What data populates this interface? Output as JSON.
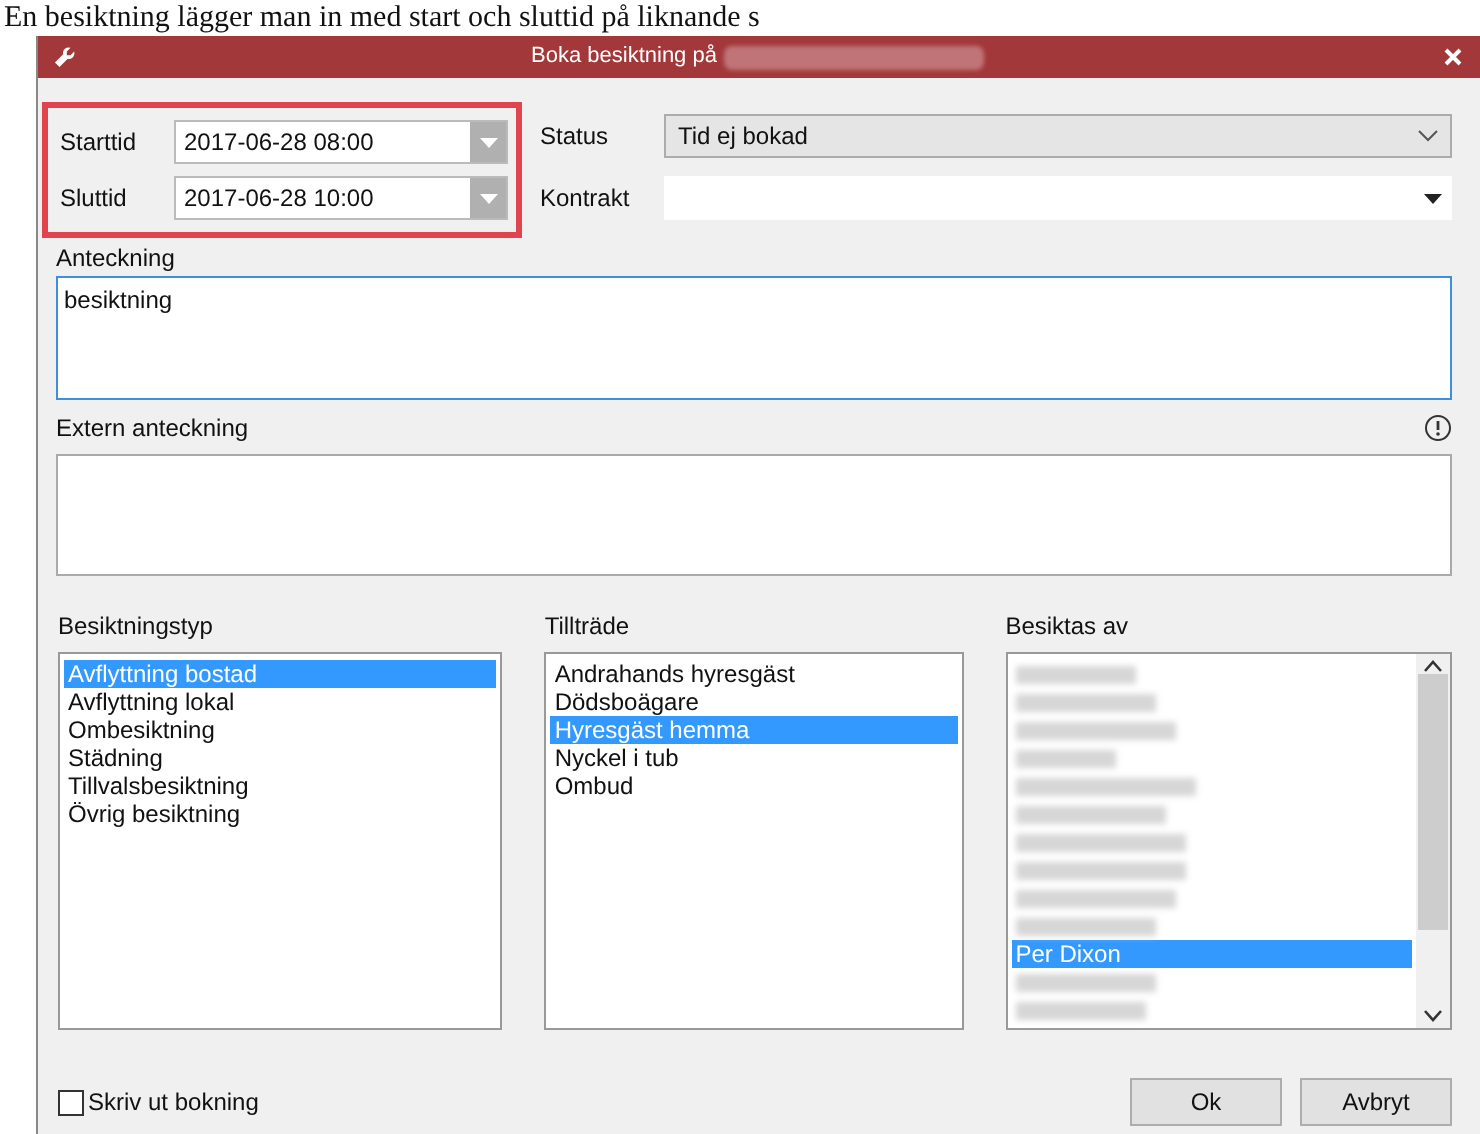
{
  "document_text": "En besiktning lägger man in med start och sluttid på liknande s",
  "dialog": {
    "title": "Boka besiktning på",
    "times": {
      "highlighted": true,
      "fields": [
        {
          "label": "Starttid",
          "value": "2017-06-28 08:00"
        },
        {
          "label": "Sluttid",
          "value": "2017-06-28 10:00"
        }
      ]
    },
    "status": {
      "label": "Status",
      "value": "Tid ej bokad"
    },
    "contract": {
      "label": "Kontrakt"
    },
    "note": {
      "label": "Anteckning",
      "value": "besiktning"
    },
    "external_note": {
      "label": "Extern anteckning"
    },
    "lists": [
      {
        "label": "Besiktningstyp",
        "scrollable": false,
        "items": [
          {
            "kind": "text",
            "text": "Avflyttning bostad",
            "selected": true
          },
          {
            "kind": "text",
            "text": "Avflyttning lokal",
            "selected": false
          },
          {
            "kind": "text",
            "text": "Ombesiktning",
            "selected": false
          },
          {
            "kind": "text",
            "text": "Städning",
            "selected": false
          },
          {
            "kind": "text",
            "text": "Tillvalsbesiktning",
            "selected": false
          },
          {
            "kind": "text",
            "text": "Övrig besiktning",
            "selected": false
          }
        ]
      },
      {
        "label": "Tillträde",
        "scrollable": false,
        "items": [
          {
            "kind": "text",
            "text": "Andrahands hyresgäst",
            "selected": false
          },
          {
            "kind": "text",
            "text": "Dödsboägare",
            "selected": false
          },
          {
            "kind": "text",
            "text": "Hyresgäst hemma",
            "selected": true
          },
          {
            "kind": "text",
            "text": "Nyckel i tub",
            "selected": false
          },
          {
            "kind": "text",
            "text": "Ombud",
            "selected": false
          }
        ]
      },
      {
        "label": "Besiktas av",
        "scrollable": true,
        "items": [
          {
            "kind": "blurred",
            "selected": false
          },
          {
            "kind": "blurred",
            "selected": false
          },
          {
            "kind": "blurred",
            "selected": false
          },
          {
            "kind": "blurred",
            "selected": false
          },
          {
            "kind": "blurred",
            "selected": false
          },
          {
            "kind": "blurred",
            "selected": false
          },
          {
            "kind": "blurred",
            "selected": false
          },
          {
            "kind": "blurred",
            "selected": false
          },
          {
            "kind": "blurred",
            "selected": false
          },
          {
            "kind": "blurred",
            "selected": false
          },
          {
            "kind": "text",
            "text": "Per Dixon",
            "selected": true
          },
          {
            "kind": "blurred",
            "selected": false
          },
          {
            "kind": "blurred",
            "selected": false
          }
        ]
      }
    ],
    "print": {
      "label": "Skriv ut bokning",
      "checked": false
    },
    "buttons": [
      "Ok",
      "Avbryt"
    ]
  }
}
